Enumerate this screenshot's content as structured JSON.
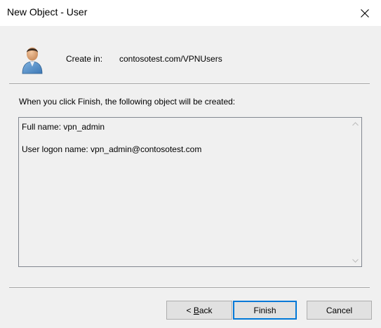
{
  "window": {
    "title": "New Object - User"
  },
  "header": {
    "create_in_label": "Create in:",
    "create_in_value": "contosotest.com/VPNUsers",
    "icon": "user-icon"
  },
  "instruction": "When you click Finish, the following object will be created:",
  "summary": {
    "full_name_line": "Full name: vpn_admin",
    "logon_name_line": "User logon name: vpn_admin@contosotest.com"
  },
  "buttons": {
    "back_label": "< Back",
    "finish_label": "Finish",
    "cancel_label": "Cancel"
  },
  "colors": {
    "default_button_border": "#0078d7",
    "dialog_background": "#f0f0f0"
  }
}
